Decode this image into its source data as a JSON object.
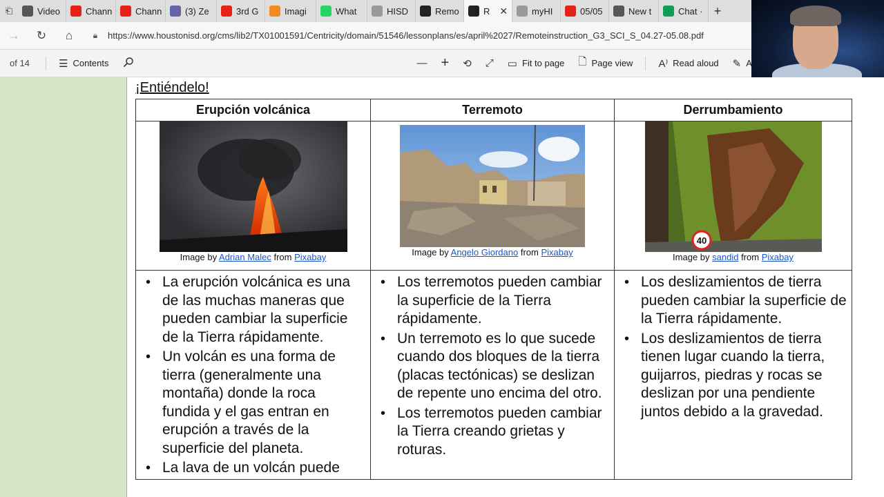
{
  "browser": {
    "tabs": [
      {
        "label": "Video",
        "icon": "page-icon",
        "color": "#555555"
      },
      {
        "label": "Chann",
        "icon": "youtube-icon",
        "color": "#e62117"
      },
      {
        "label": "Chann",
        "icon": "youtube-icon",
        "color": "#e62117"
      },
      {
        "label": "(3) Ze",
        "icon": "teams-icon",
        "color": "#6264a7"
      },
      {
        "label": "3rd G",
        "icon": "youtube-icon",
        "color": "#e62117"
      },
      {
        "label": "Imagi",
        "icon": "pixabay-icon",
        "color": "#f28b1e"
      },
      {
        "label": "What",
        "icon": "whatsapp-icon",
        "color": "#25d366"
      },
      {
        "label": "HISD",
        "icon": "hisd-icon",
        "color": "#9a9a9a"
      },
      {
        "label": "Remo",
        "icon": "blackboard-icon",
        "color": "#222222"
      },
      {
        "label": "R",
        "icon": "blackboard-icon",
        "color": "#222222",
        "active": true
      },
      {
        "label": "myHI",
        "icon": "hisd-icon",
        "color": "#9a9a9a"
      },
      {
        "label": "05/05",
        "icon": "youtube-icon",
        "color": "#e62117"
      },
      {
        "label": "New t",
        "icon": "newsfeed-icon",
        "color": "#555555"
      },
      {
        "label": "Chat ·",
        "icon": "classroom-icon",
        "color": "#0f9d58"
      }
    ],
    "url": "https://www.houstonisd.org/cms/lib2/TX01001591/Centricity/domain/51546/lessonplans/es/april%2027/Remoteinstruction_G3_SCI_S_04.27-05.08.pdf"
  },
  "pdf_toolbar": {
    "page_count": "of 14",
    "contents_label": "Contents",
    "fit_label": "Fit to page",
    "page_view_label": "Page view",
    "read_aloud_label": "Read aloud",
    "annotate_label": "A"
  },
  "document": {
    "heading": "¡Entiéndelo!",
    "columns": [
      {
        "title": "Erupción volcánica",
        "caption_prefix": "Image by ",
        "author": "Adrian Malec",
        "caption_mid": " from ",
        "source": "Pixabay",
        "facts": [
          "La erupción volcánica es una de las muchas maneras que pueden cambiar la superficie de la Tierra rápidamente.",
          "Un volcán es una forma de tierra (generalmente una montaña) donde la roca fundida y el gas entran en erupción a través de la superficie del planeta.",
          "La lava de un volcán puede"
        ]
      },
      {
        "title": "Terremoto",
        "caption_prefix": "Image by ",
        "author": "Angelo Giordano",
        "caption_mid": " from ",
        "source": "Pixabay",
        "facts": [
          "Los terremotos pueden cambiar la superficie de la Tierra rápidamente.",
          "Un terremoto es lo que sucede cuando dos bloques de la tierra (placas tectónicas) se deslizan de repente uno encima del otro.",
          "Los terremotos pueden cambiar la Tierra creando grietas y roturas."
        ]
      },
      {
        "title": "Derrumbamiento",
        "caption_prefix": "Image by ",
        "author": "sandid",
        "caption_mid": " from ",
        "source": "Pixabay",
        "sign_text": "40",
        "facts": [
          "Los deslizamientos de tierra pueden cambiar la superficie de la Tierra rápidamente.",
          "Los deslizamientos de tierra tienen lugar cuando la tierra, guijarros, piedras y rocas se deslizan por una pendiente juntos debido a la gravedad."
        ]
      }
    ]
  }
}
